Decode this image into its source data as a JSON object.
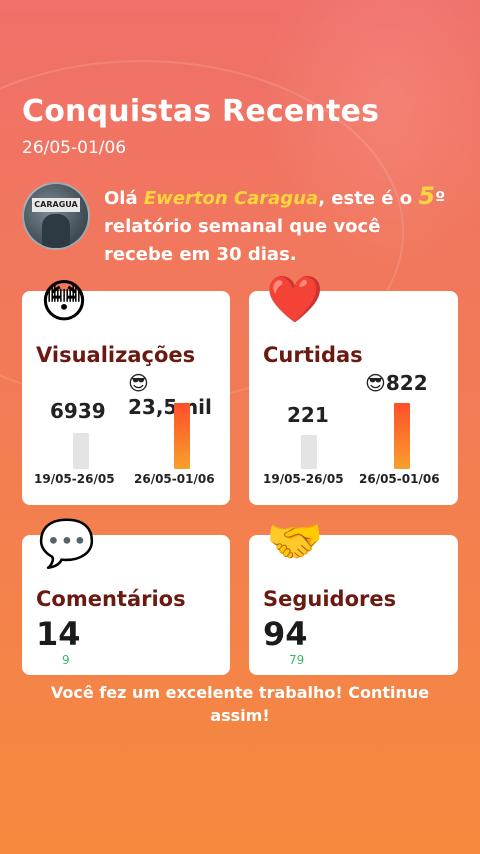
{
  "header": {
    "title": "Conquistas Recentes",
    "dates": "26/05-01/06"
  },
  "avatar_sign": "CARAGUA",
  "intro": {
    "prefix": "Olá ",
    "name": "Ewerton Caragua",
    "mid": ", este é o ",
    "number": "5",
    "suffix": "º relatório semanal que você recebe em 30 dias."
  },
  "cards": {
    "views": {
      "emoji": "😳",
      "title": "Visualizações",
      "best_emoji": "😎",
      "best_value": "23,5mil",
      "previous_value": "6939",
      "previous_range": "19/05-26/05",
      "current_range": "26/05-01/06"
    },
    "likes": {
      "emoji": "❤️",
      "title": "Curtidas",
      "best_emoji": "😎",
      "best_value": "822",
      "previous_value": "221",
      "previous_range": "19/05-26/05",
      "current_range": "26/05-01/06"
    },
    "comments": {
      "emoji": "💬",
      "title": "Comentários",
      "value": "14",
      "previous": "9"
    },
    "followers": {
      "emoji": "🤝",
      "title": "Seguidores",
      "value": "94",
      "previous": "79"
    }
  },
  "footer": "Você fez um excelente trabalho! Continue assim!"
}
